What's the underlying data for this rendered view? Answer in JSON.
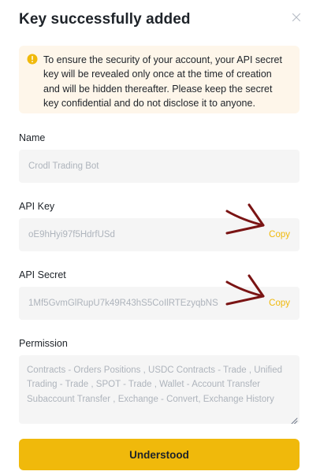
{
  "dialog": {
    "title": "Key successfully added",
    "close_icon": "close-icon"
  },
  "notice": {
    "icon": "warning-icon",
    "text": "To ensure the security of your account, your API secret key will be revealed only once at the time of creation and will be hidden thereafter. Please keep the secret key confidential and do not disclose it to anyone."
  },
  "name_field": {
    "label": "Name",
    "value": "Crodl Trading Bot"
  },
  "api_key_field": {
    "label": "API Key",
    "value": "oE9hHyi97f5HdrfUSd",
    "copy_label": "Copy"
  },
  "api_secret_field": {
    "label": "API Secret",
    "value": "1Mf5GvmGlRupU7k49R43hS5CoIlRTEzyqbNS",
    "copy_label": "Copy"
  },
  "permission_field": {
    "label": "Permission",
    "value": "Contracts - Orders Positions  , USDC Contracts - Trade  , Unified Trading - Trade  , SPOT - Trade  , Wallet - Account Transfer Subaccount Transfer  , Exchange - Convert, Exchange History"
  },
  "footer": {
    "button_label": "Understood"
  },
  "colors": {
    "accent": "#f0b90b",
    "notice_bg": "#fef6ea",
    "field_bg": "#f5f5f5",
    "annotation_arrow": "#7a1414"
  }
}
